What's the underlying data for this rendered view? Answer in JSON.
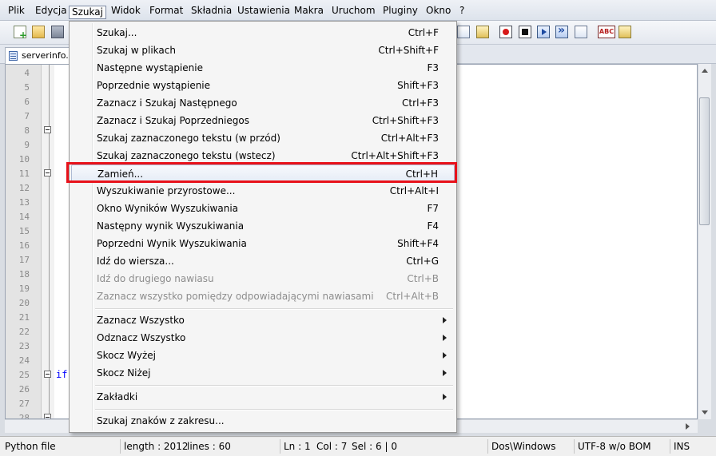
{
  "menubar": {
    "items": [
      "Plik",
      "Edycja",
      "Szukaj",
      "Widok",
      "Format",
      "Składnia",
      "Ustawienia",
      "Makra",
      "Uruchom",
      "Pluginy",
      "Okno",
      "?"
    ],
    "active": "Szukaj"
  },
  "tab": {
    "label": "serverinfo.py"
  },
  "editor": {
    "line_numbers": [
      "4",
      "5",
      "6",
      "7",
      "8",
      "9",
      "10",
      "11",
      "12",
      "13",
      "14",
      "15",
      "16",
      "17",
      "18",
      "19",
      "20",
      "21",
      "22",
      "23",
      "24",
      "25",
      "26",
      "27",
      "28"
    ],
    "code_line_25": "if"
  },
  "menu": {
    "items": [
      {
        "label": "Szukaj...",
        "shortcut": "Ctrl+F"
      },
      {
        "label": "Szukaj w plikach",
        "shortcut": "Ctrl+Shift+F"
      },
      {
        "label": "Następne wystąpienie",
        "shortcut": "F3"
      },
      {
        "label": "Poprzednie wystąpienie",
        "shortcut": "Shift+F3"
      },
      {
        "label": "Zaznacz i Szukaj Następnego",
        "shortcut": "Ctrl+F3"
      },
      {
        "label": "Zaznacz i Szukaj Poprzedniegos",
        "shortcut": "Ctrl+Shift+F3"
      },
      {
        "label": "Szukaj zaznaczonego tekstu (w przód)",
        "shortcut": "Ctrl+Alt+F3"
      },
      {
        "label": "Szukaj zaznaczonego tekstu (wstecz)",
        "shortcut": "Ctrl+Alt+Shift+F3"
      },
      {
        "label": "Zamień...",
        "shortcut": "Ctrl+H"
      },
      {
        "label": "Wyszukiwanie przyrostowe...",
        "shortcut": "Ctrl+Alt+I"
      },
      {
        "label": "Okno Wyników Wyszukiwania",
        "shortcut": "F7"
      },
      {
        "label": "Następny wynik Wyszukiwania",
        "shortcut": "F4"
      },
      {
        "label": "Poprzedni Wynik Wyszukiwania",
        "shortcut": "Shift+F4"
      },
      {
        "label": "Idź do wiersza...",
        "shortcut": "Ctrl+G"
      },
      {
        "label": "Idź do drugiego nawiasu",
        "shortcut": "Ctrl+B"
      },
      {
        "label": "Zaznacz wszystko pomiędzy odpowiadającymi nawiasami",
        "shortcut": "Ctrl+Alt+B"
      },
      {
        "label": "Zaznacz Wszystko",
        "shortcut": ""
      },
      {
        "label": "Odznacz Wszystko",
        "shortcut": ""
      },
      {
        "label": "Skocz Wyżej",
        "shortcut": ""
      },
      {
        "label": "Skocz Niżej",
        "shortcut": ""
      },
      {
        "label": "Zakładki",
        "shortcut": ""
      },
      {
        "label": "Szukaj znaków z zakresu...",
        "shortcut": ""
      }
    ]
  },
  "statusbar": {
    "file_type": "Python file",
    "length": "length : 2012",
    "lines": "lines : 60",
    "ln": "Ln : 1",
    "col": "Col : 7",
    "sel": "Sel : 6 | 0",
    "eol": "Dos\\Windows",
    "encoding": "UTF-8 w/o BOM",
    "mode": "INS"
  },
  "colors": {
    "highlight_box": "#e8111a",
    "keyword": "#0000ff"
  }
}
